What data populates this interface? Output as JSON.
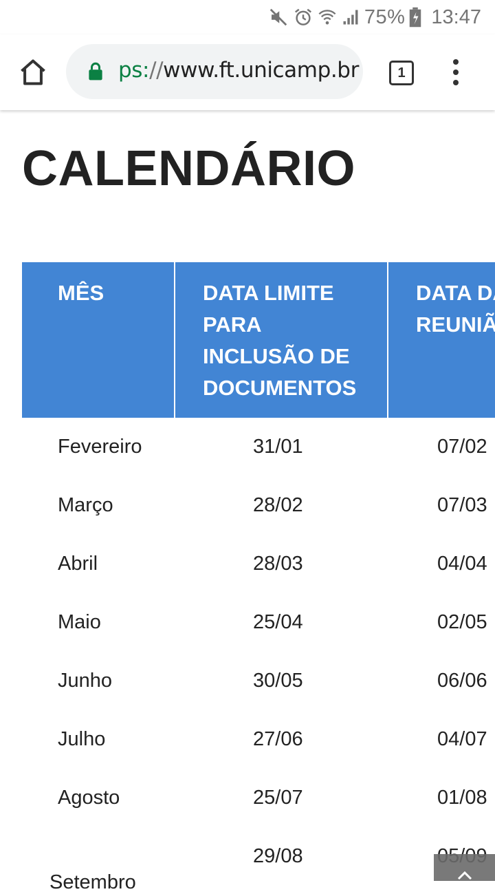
{
  "status_bar": {
    "icons": [
      "mute-icon",
      "alarm-icon",
      "wifi-icon",
      "signal-icon",
      "battery-icon"
    ],
    "battery": "75%",
    "time": "13:47"
  },
  "browser": {
    "url_scheme": "ps:",
    "url_sep": "//",
    "url_host": "www.ft.unicamp.br",
    "tab_count": "1",
    "lock_color": "#0b8043"
  },
  "page": {
    "title": "CALENDÁRIO"
  },
  "table": {
    "header_color": "#4285d4",
    "headers": {
      "month": "MÊS",
      "deadline": "DATA LIMITE PARA INCLUSÃO DE DOCUMENTOS",
      "meeting": "DATA DA REUNIÃ"
    },
    "rows": [
      {
        "month": "Fevereiro",
        "deadline": "31/01",
        "meeting": "07/02"
      },
      {
        "month": "Março",
        "deadline": "28/02",
        "meeting": "07/03"
      },
      {
        "month": "Abril",
        "deadline": "28/03",
        "meeting": "04/04"
      },
      {
        "month": "Maio",
        "deadline": "25/04",
        "meeting": "02/05"
      },
      {
        "month": "Junho",
        "deadline": "30/05",
        "meeting": "06/06"
      },
      {
        "month": "Julho",
        "deadline": "27/06",
        "meeting": "04/07"
      },
      {
        "month": "Agosto",
        "deadline": "25/07",
        "meeting": "01/08"
      },
      {
        "month": "",
        "deadline": "29/08",
        "meeting": "05/09"
      }
    ],
    "partial_month": "Setembro"
  }
}
